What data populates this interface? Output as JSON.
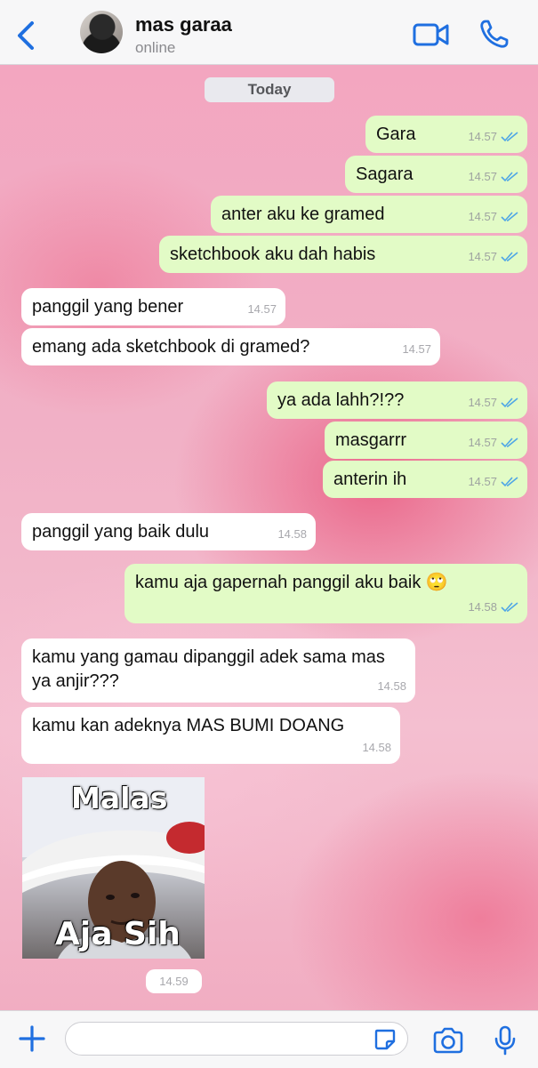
{
  "header": {
    "contact_name": "mas garaa",
    "status": "online",
    "icons": [
      "chevron-left-icon",
      "video-call-icon",
      "phone-icon"
    ],
    "accent_color": "#1f6fe0"
  },
  "date_divider": "Today",
  "messages": [
    {
      "dir": "out",
      "text": "Gara",
      "time": "14.57",
      "read": true
    },
    {
      "dir": "out",
      "text": "Sagara",
      "time": "14.57",
      "read": true
    },
    {
      "dir": "out",
      "text": "anter aku ke gramed",
      "time": "14.57",
      "read": true
    },
    {
      "dir": "out",
      "text": "sketchbook aku dah habis",
      "time": "14.57",
      "read": true
    },
    {
      "dir": "in",
      "text": "panggil yang bener",
      "time": "14.57"
    },
    {
      "dir": "in",
      "text": "emang ada sketchbook di gramed?",
      "time": "14.57"
    },
    {
      "dir": "out",
      "text": "ya ada lahh?!??",
      "time": "14.57",
      "read": true
    },
    {
      "dir": "out",
      "text": "masgarrr",
      "time": "14.57",
      "read": true
    },
    {
      "dir": "out",
      "text": "anterin ih",
      "time": "14.57",
      "read": true
    },
    {
      "dir": "in",
      "text": "panggil yang baik dulu",
      "time": "14.58"
    },
    {
      "dir": "out",
      "text": "kamu aja gapernah panggil aku baik 🙄",
      "time": "14.58",
      "read": true
    },
    {
      "dir": "in",
      "text": "kamu yang gamau dipanggil adek sama mas ya anjir???",
      "time": "14.58"
    },
    {
      "dir": "in",
      "text": "kamu kan adeknya MAS BUMI DOANG",
      "time": "14.58"
    }
  ],
  "sticker": {
    "caption_top": "Malas",
    "caption_bottom": "Aja Sih",
    "time": "14.59"
  },
  "input": {
    "placeholder": "",
    "icons": [
      "plus-icon",
      "sticker-icon",
      "camera-icon",
      "microphone-icon"
    ]
  },
  "colors": {
    "outgoing_bubble": "#e2fbc6",
    "incoming_bubble": "#ffffff",
    "read_ticks": "#4fa6e6"
  }
}
